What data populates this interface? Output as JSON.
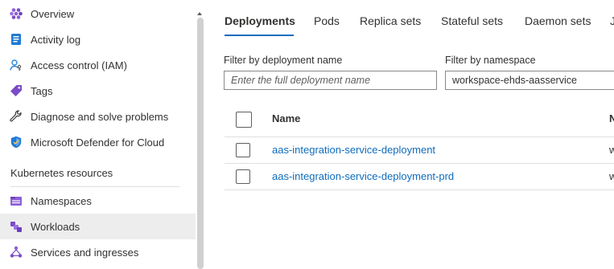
{
  "sidebar": {
    "items": [
      {
        "label": "Overview",
        "icon": "overview-icon"
      },
      {
        "label": "Activity log",
        "icon": "activity-log-icon"
      },
      {
        "label": "Access control (IAM)",
        "icon": "access-control-icon"
      },
      {
        "label": "Tags",
        "icon": "tag-icon"
      },
      {
        "label": "Diagnose and solve problems",
        "icon": "wrench-icon"
      },
      {
        "label": "Microsoft Defender for Cloud",
        "icon": "shield-icon"
      }
    ],
    "section_title": "Kubernetes resources",
    "section_items": [
      {
        "label": "Namespaces",
        "icon": "namespaces-icon"
      },
      {
        "label": "Workloads",
        "icon": "workloads-icon",
        "selected": true
      },
      {
        "label": "Services and ingresses",
        "icon": "services-icon"
      }
    ]
  },
  "tabs": {
    "deployments": "Deployments",
    "pods": "Pods",
    "replica_sets": "Replica sets",
    "stateful_sets": "Stateful sets",
    "daemon_sets": "Daemon sets",
    "jobs": "J"
  },
  "filters": {
    "name_label": "Filter by deployment name",
    "name_placeholder": "Enter the full deployment name",
    "name_value": "",
    "namespace_label": "Filter by namespace",
    "namespace_value": "workspace-ehds-aasservice"
  },
  "table": {
    "headers": {
      "name": "Name",
      "namespace": "N"
    },
    "rows": [
      {
        "name": "aas-integration-service-deployment",
        "namespace": "w"
      },
      {
        "name": "aas-integration-service-deployment-prd",
        "namespace": "w"
      }
    ]
  },
  "colors": {
    "accent": "#0f6cbd",
    "selected_bg": "#ededed"
  }
}
